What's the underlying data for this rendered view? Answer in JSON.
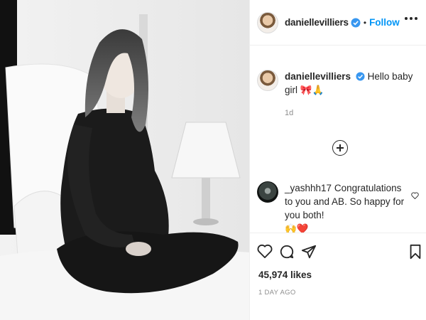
{
  "post": {
    "image_alt": "",
    "username": "daniellevilliers",
    "follow_label": "Follow",
    "separator": "•"
  },
  "caption": {
    "username": "daniellevilliers",
    "text": "Hello baby girl",
    "emojis": "🎀🙏",
    "time": "1d"
  },
  "comment": {
    "username": "_yashhh17",
    "text": "Congratulations to you and AB. So happy for you both!",
    "emojis": "🙌❤️"
  },
  "footer": {
    "likes": "45,974 likes",
    "posted": "1 DAY AGO"
  },
  "icons": {
    "like": "heart-icon",
    "comment": "comment-icon",
    "share": "share-icon",
    "save": "bookmark-icon",
    "more": "more-options-icon",
    "load_more": "plus-circle-icon",
    "verified": "verified-badge-icon"
  },
  "colors": {
    "follow": "#0095f6",
    "verified": "#3897f0",
    "muted": "#8e8e8e"
  }
}
